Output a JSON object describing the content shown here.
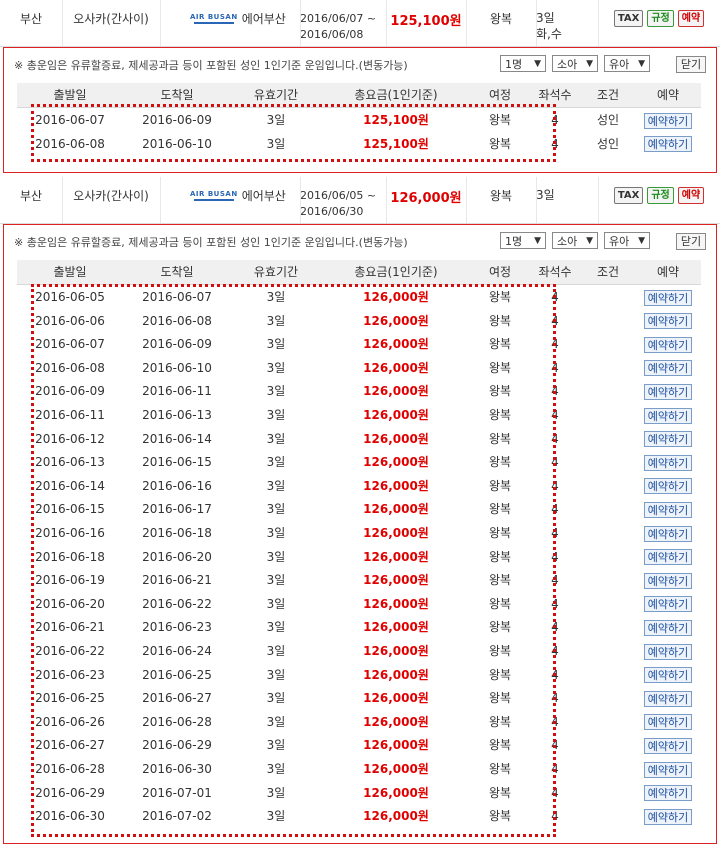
{
  "offers": [
    {
      "summary": {
        "departure": "부산",
        "arrival": "오사카(간사이)",
        "airline_logo": "AIR BUSAN",
        "airline": "에어부산",
        "date_start": "2016/06/07 ~",
        "date_end": "2016/06/08",
        "price": "125,100원",
        "trip": "왕복",
        "validity": "3일",
        "validity_days": "화,수",
        "btn_tax": "TAX",
        "btn_rule": "규정",
        "btn_book": "예약"
      },
      "note": "※ 총운임은 유류할증료, 제세공과금 등이 포함된 성인 1인기준 운임입니다.(변동가능)",
      "selects": {
        "adult": "1명",
        "child": "소아",
        "infant": "유아"
      },
      "close_label": "닫기",
      "headers": [
        "출발일",
        "도착일",
        "유효기간",
        "총요금(1인기준)",
        "여정",
        "좌석수",
        "조건",
        "예약"
      ],
      "rows": [
        {
          "dep": "2016-06-07",
          "arr": "2016-06-09",
          "valid": "3일",
          "price": "125,100원",
          "trip": "왕복",
          "seats": "4",
          "cond": "성인",
          "book": "예약하기"
        },
        {
          "dep": "2016-06-08",
          "arr": "2016-06-10",
          "valid": "3일",
          "price": "125,100원",
          "trip": "왕복",
          "seats": "4",
          "cond": "성인",
          "book": "예약하기"
        }
      ]
    },
    {
      "summary": {
        "departure": "부산",
        "arrival": "오사카(간사이)",
        "airline_logo": "AIR BUSAN",
        "airline": "에어부산",
        "date_start": "2016/06/05 ~",
        "date_end": "2016/06/30",
        "price": "126,000원",
        "trip": "왕복",
        "validity": "3일",
        "validity_days": "",
        "btn_tax": "TAX",
        "btn_rule": "규정",
        "btn_book": "예약"
      },
      "note": "※ 총운임은 유류할증료, 제세공과금 등이 포함된 성인 1인기준 운임입니다.(변동가능)",
      "selects": {
        "adult": "1명",
        "child": "소아",
        "infant": "유아"
      },
      "close_label": "닫기",
      "headers": [
        "출발일",
        "도착일",
        "유효기간",
        "총요금(1인기준)",
        "여정",
        "좌석수",
        "조건",
        "예약"
      ],
      "rows": [
        {
          "dep": "2016-06-05",
          "arr": "2016-06-07",
          "valid": "3일",
          "price": "126,000원",
          "trip": "왕복",
          "seats": "4",
          "cond": "",
          "book": "예약하기"
        },
        {
          "dep": "2016-06-06",
          "arr": "2016-06-08",
          "valid": "3일",
          "price": "126,000원",
          "trip": "왕복",
          "seats": "4",
          "cond": "",
          "book": "예약하기"
        },
        {
          "dep": "2016-06-07",
          "arr": "2016-06-09",
          "valid": "3일",
          "price": "126,000원",
          "trip": "왕복",
          "seats": "4",
          "cond": "",
          "book": "예약하기"
        },
        {
          "dep": "2016-06-08",
          "arr": "2016-06-10",
          "valid": "3일",
          "price": "126,000원",
          "trip": "왕복",
          "seats": "4",
          "cond": "",
          "book": "예약하기"
        },
        {
          "dep": "2016-06-09",
          "arr": "2016-06-11",
          "valid": "3일",
          "price": "126,000원",
          "trip": "왕복",
          "seats": "4",
          "cond": "",
          "book": "예약하기"
        },
        {
          "dep": "2016-06-11",
          "arr": "2016-06-13",
          "valid": "3일",
          "price": "126,000원",
          "trip": "왕복",
          "seats": "4",
          "cond": "",
          "book": "예약하기"
        },
        {
          "dep": "2016-06-12",
          "arr": "2016-06-14",
          "valid": "3일",
          "price": "126,000원",
          "trip": "왕복",
          "seats": "4",
          "cond": "",
          "book": "예약하기"
        },
        {
          "dep": "2016-06-13",
          "arr": "2016-06-15",
          "valid": "3일",
          "price": "126,000원",
          "trip": "왕복",
          "seats": "4",
          "cond": "",
          "book": "예약하기"
        },
        {
          "dep": "2016-06-14",
          "arr": "2016-06-16",
          "valid": "3일",
          "price": "126,000원",
          "trip": "왕복",
          "seats": "4",
          "cond": "",
          "book": "예약하기"
        },
        {
          "dep": "2016-06-15",
          "arr": "2016-06-17",
          "valid": "3일",
          "price": "126,000원",
          "trip": "왕복",
          "seats": "4",
          "cond": "",
          "book": "예약하기"
        },
        {
          "dep": "2016-06-16",
          "arr": "2016-06-18",
          "valid": "3일",
          "price": "126,000원",
          "trip": "왕복",
          "seats": "4",
          "cond": "",
          "book": "예약하기"
        },
        {
          "dep": "2016-06-18",
          "arr": "2016-06-20",
          "valid": "3일",
          "price": "126,000원",
          "trip": "왕복",
          "seats": "4",
          "cond": "",
          "book": "예약하기"
        },
        {
          "dep": "2016-06-19",
          "arr": "2016-06-21",
          "valid": "3일",
          "price": "126,000원",
          "trip": "왕복",
          "seats": "4",
          "cond": "",
          "book": "예약하기"
        },
        {
          "dep": "2016-06-20",
          "arr": "2016-06-22",
          "valid": "3일",
          "price": "126,000원",
          "trip": "왕복",
          "seats": "4",
          "cond": "",
          "book": "예약하기"
        },
        {
          "dep": "2016-06-21",
          "arr": "2016-06-23",
          "valid": "3일",
          "price": "126,000원",
          "trip": "왕복",
          "seats": "4",
          "cond": "",
          "book": "예약하기"
        },
        {
          "dep": "2016-06-22",
          "arr": "2016-06-24",
          "valid": "3일",
          "price": "126,000원",
          "trip": "왕복",
          "seats": "4",
          "cond": "",
          "book": "예약하기"
        },
        {
          "dep": "2016-06-23",
          "arr": "2016-06-25",
          "valid": "3일",
          "price": "126,000원",
          "trip": "왕복",
          "seats": "4",
          "cond": "",
          "book": "예약하기"
        },
        {
          "dep": "2016-06-25",
          "arr": "2016-06-27",
          "valid": "3일",
          "price": "126,000원",
          "trip": "왕복",
          "seats": "4",
          "cond": "",
          "book": "예약하기"
        },
        {
          "dep": "2016-06-26",
          "arr": "2016-06-28",
          "valid": "3일",
          "price": "126,000원",
          "trip": "왕복",
          "seats": "4",
          "cond": "",
          "book": "예약하기"
        },
        {
          "dep": "2016-06-27",
          "arr": "2016-06-29",
          "valid": "3일",
          "price": "126,000원",
          "trip": "왕복",
          "seats": "4",
          "cond": "",
          "book": "예약하기"
        },
        {
          "dep": "2016-06-28",
          "arr": "2016-06-30",
          "valid": "3일",
          "price": "126,000원",
          "trip": "왕복",
          "seats": "4",
          "cond": "",
          "book": "예약하기"
        },
        {
          "dep": "2016-06-29",
          "arr": "2016-07-01",
          "valid": "3일",
          "price": "126,000원",
          "trip": "왕복",
          "seats": "4",
          "cond": "",
          "book": "예약하기"
        },
        {
          "dep": "2016-06-30",
          "arr": "2016-07-02",
          "valid": "3일",
          "price": "126,000원",
          "trip": "왕복",
          "seats": "4",
          "cond": "",
          "book": "예약하기"
        }
      ]
    }
  ],
  "colors": {
    "price": "#e00000",
    "highlight": "#d01010",
    "panel_border": "#dd2222"
  }
}
